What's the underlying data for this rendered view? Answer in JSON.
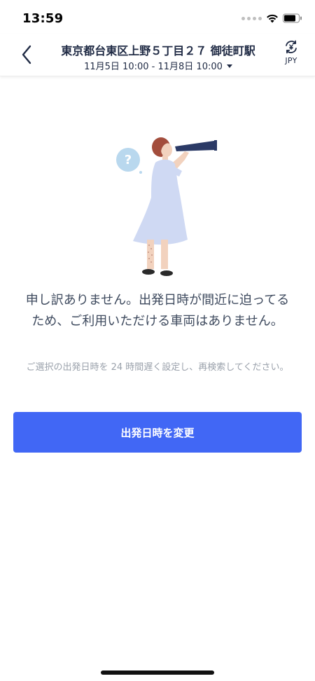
{
  "status_bar": {
    "time": "13:59"
  },
  "header": {
    "title": "東京都台東区上野５丁目２７ 御徒町駅",
    "date_range": "11月5日 10:00 - 11月8日 10:00",
    "currency": "JPY",
    "back_icon": "chevron-left-icon",
    "currency_icon": "currency-exchange-icon"
  },
  "main": {
    "illustration": "woman-with-telescope-illustration",
    "message_title": "申し訳ありません。出発日時が間近に迫ってるため、ご利用いただける車両はありません。",
    "message_sub": "ご選択の出発日時を 24 時間遅く設定し、再検索してください。",
    "change_button": "出発日時を変更"
  },
  "colors": {
    "accent": "#4167f5",
    "title_text": "#1f2a44",
    "message_text": "#3e4a5e",
    "sub_text": "#9aa1ab"
  }
}
